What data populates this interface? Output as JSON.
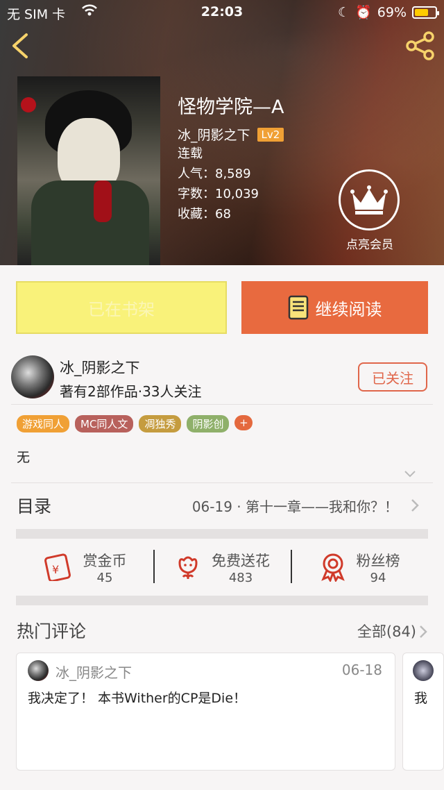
{
  "status_bar": {
    "carrier": "无 SIM 卡",
    "time": "22:03",
    "battery": "69%",
    "battery_level": 0.69
  },
  "book": {
    "title": "怪物学院—A",
    "author": "冰_阴影之下",
    "level": "Lv2",
    "status": "连载",
    "popularity": "人气：8,589",
    "word_count": "字数：10,039",
    "favorites": "收藏：68"
  },
  "vip": {
    "label": "点亮会员"
  },
  "actions": {
    "shelf_label": "已在书架",
    "read_label": "继续阅读"
  },
  "author_info": {
    "name": "冰_阴影之下",
    "stats": "著有2部作品·33人关注",
    "follow_label": "已关注"
  },
  "tags": [
    {
      "label": "游戏同人",
      "color": "#f0a035"
    },
    {
      "label": "MC同人文",
      "color": "#b8615c"
    },
    {
      "label": "凋独秀",
      "color": "#c59c3f"
    },
    {
      "label": "阴影创",
      "color": "#8fb06a"
    }
  ],
  "tag_add": "+",
  "intro": "无",
  "toc": {
    "title": "目录",
    "latest": "06-19 · 第十一章——我和你？！"
  },
  "stats": [
    {
      "label": "赏金币",
      "value": "45",
      "icon": "coin-envelope-icon"
    },
    {
      "label": "免费送花",
      "value": "483",
      "icon": "flower-icon"
    },
    {
      "label": "粉丝榜",
      "value": "94",
      "icon": "medal-icon"
    }
  ],
  "comments_section": {
    "title": "热门评论",
    "all_label": "全部(84)"
  },
  "comments": [
    {
      "user": "冰_阴影之下",
      "date": "06-18",
      "text": "我决定了！ 本书Wither的CP是Die！"
    },
    {
      "user": "",
      "date": "",
      "text": "我"
    }
  ],
  "colors": {
    "accent": "#e86a3f",
    "shelf_yellow": "#f9f27a",
    "icon_red": "#d03a2a"
  }
}
